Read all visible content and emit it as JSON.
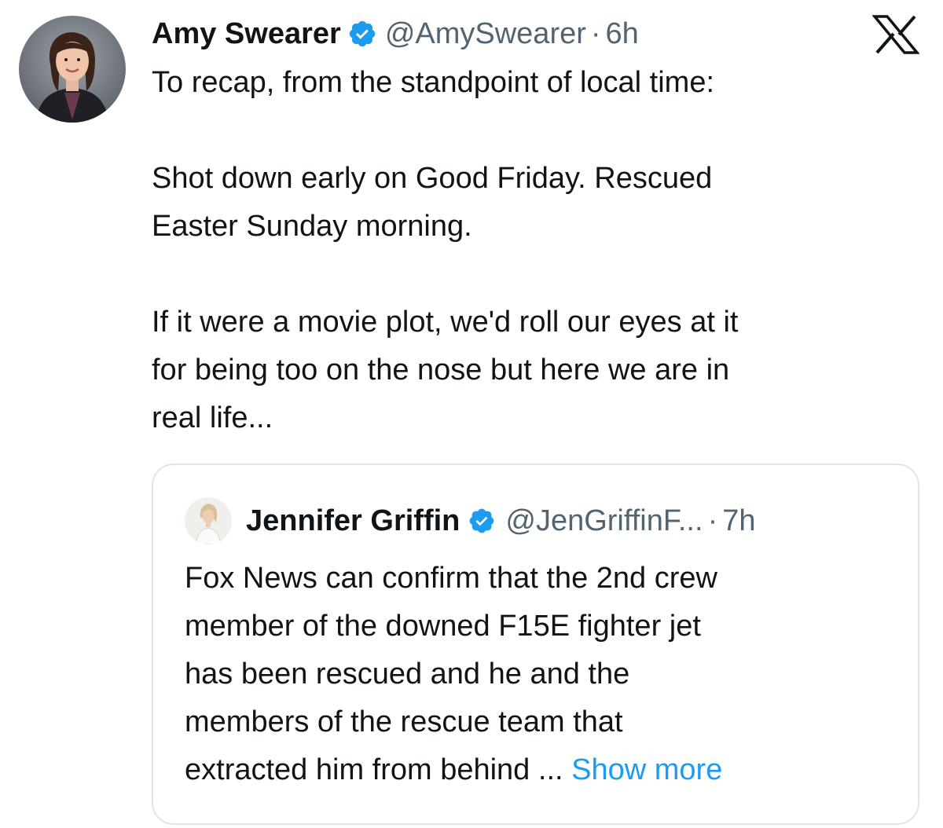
{
  "tweet": {
    "author_name": "Amy Swearer",
    "handle": "@AmySwearer",
    "separator": "·",
    "time": "6h",
    "verified_icon": "verified-badge-icon",
    "text": "To recap, from the standpoint of local time:\n\nShot down early on Good Friday. Rescued\nEaster Sunday morning.\n\nIf it were a movie plot, we'd roll our eyes at it\nfor being too on the nose but here we are in\nreal life..."
  },
  "platform": {
    "logo_icon": "x-logo-icon"
  },
  "quoted_tweet": {
    "author_name": "Jennifer Griffin",
    "handle": "@JenGriffinF...",
    "separator": "·",
    "time": "7h",
    "verified_icon": "verified-badge-icon",
    "lines": [
      "Fox News can confirm that the 2nd crew",
      "member of the downed F15E fighter jet",
      "has been rescued and he and the",
      "members of the rescue team that",
      "extracted him from behind"
    ],
    "truncation": "...",
    "show_more_label": "Show more"
  },
  "colors": {
    "text": "#0f1419",
    "secondary_text": "#536471",
    "link": "#1d9bf0",
    "verified": "#1d9bf0",
    "card_border": "#e1e5e9"
  }
}
